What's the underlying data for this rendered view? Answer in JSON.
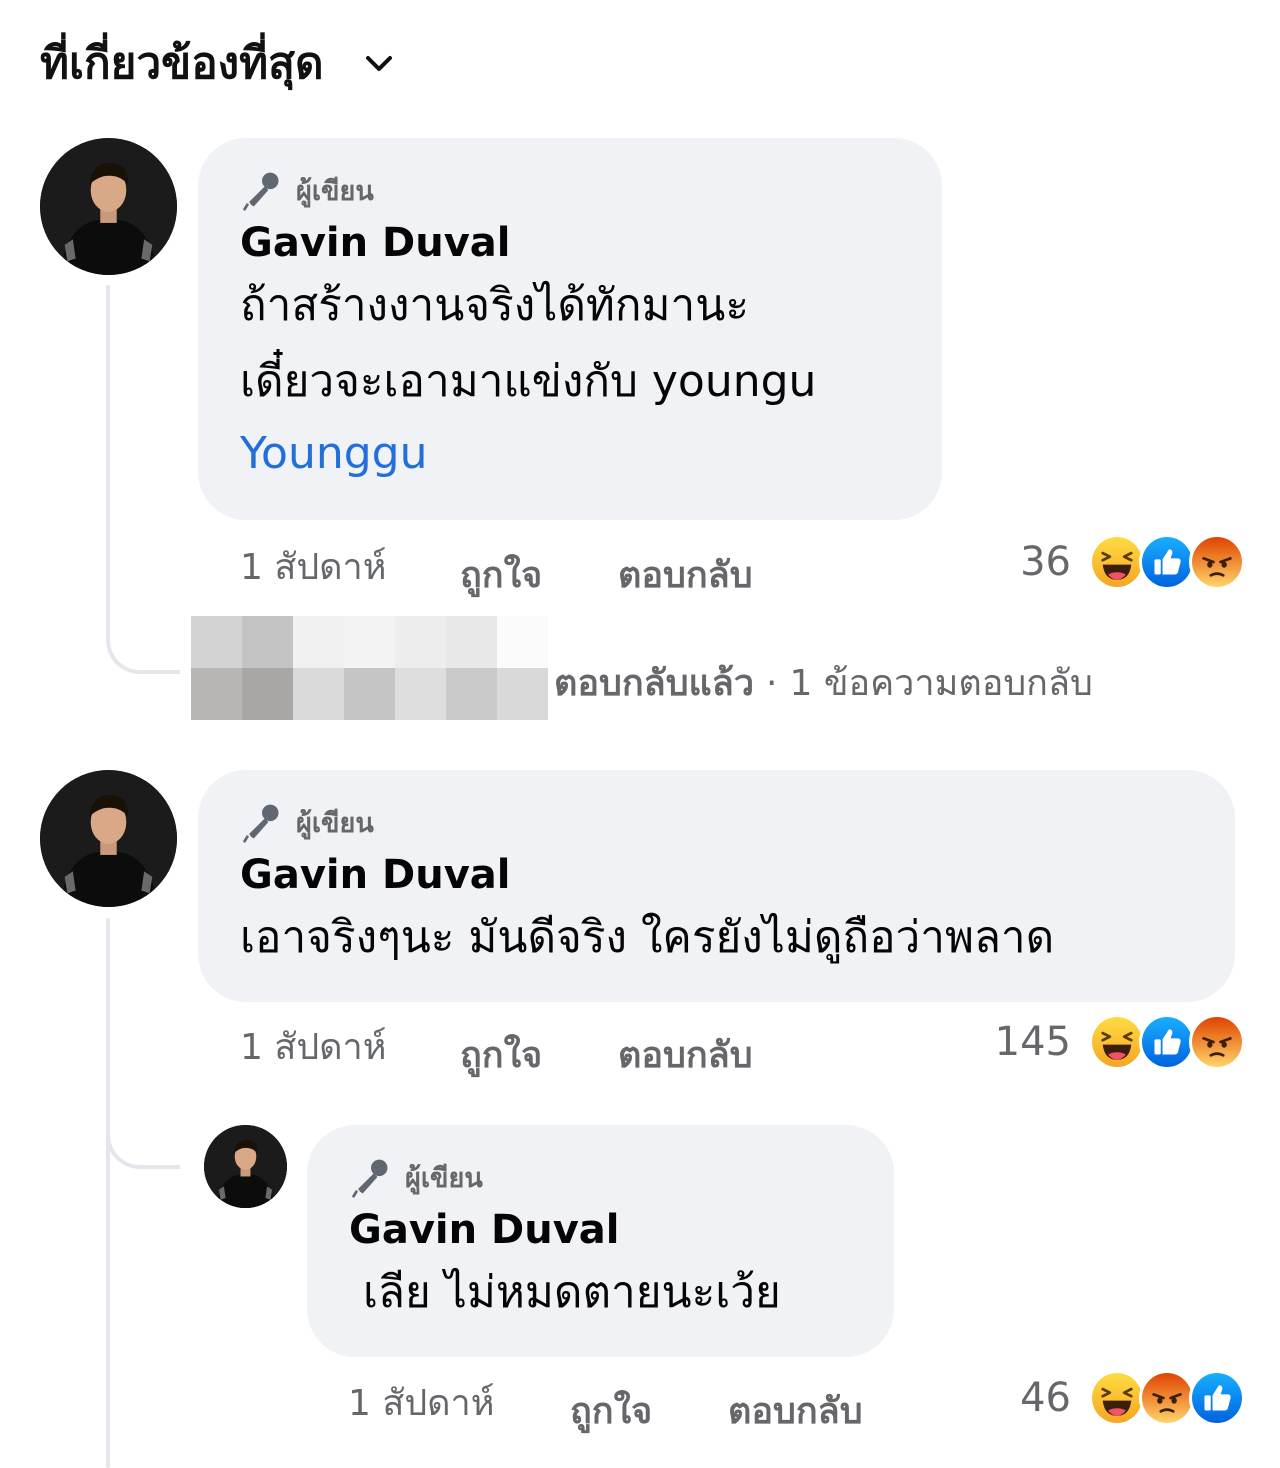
{
  "header": {
    "sort_label": "ที่เกี่ยวข้องที่สุด"
  },
  "comments": [
    {
      "badge": "ผู้เขียน",
      "author": "Gavin Duval",
      "lines": [
        "ถ้าสร้างงานจริงได้ทักมานะ",
        "เดี๋ยวจะเอามาแข่งกับ youngu"
      ],
      "mention": "Younggu",
      "time": "1 สัปดาห์",
      "like": "ถูกใจ",
      "reply": "ตอบกลับ",
      "reaction_count": "36",
      "reactions": [
        "haha-icon",
        "like-icon",
        "angry-icon"
      ],
      "replies_summary": {
        "action": "ตอบกลับแล้ว",
        "separator": "·",
        "count_text": "1 ข้อความตอบกลับ"
      }
    },
    {
      "badge": "ผู้เขียน",
      "author": "Gavin Duval",
      "text": "เอาจริงๆนะ มันดีจริง ใครยังไม่ดูถือว่าพลาด",
      "time": "1 สัปดาห์",
      "like": "ถูกใจ",
      "reply": "ตอบกลับ",
      "reaction_count": "145",
      "reactions": [
        "haha-icon",
        "like-icon",
        "angry-icon"
      ],
      "reply_comment": {
        "badge": "ผู้เขียน",
        "author": "Gavin Duval",
        "text": "เลีย ไม่หมดตายนะเว้ย",
        "time": "1 สัปดาห์",
        "like": "ถูกใจ",
        "reply": "ตอบกลับ",
        "reaction_count": "46",
        "reactions": [
          "haha-icon",
          "angry-icon",
          "like-icon"
        ]
      }
    }
  ],
  "colors": {
    "bubble": "#f0f2f5",
    "meta_text": "#65676b",
    "link": "#216fdb",
    "thread_line": "#e4e6eb",
    "like_blue": "#1877f2",
    "haha_yellow": "#f7b125",
    "angry_orange": "#e9710f"
  }
}
